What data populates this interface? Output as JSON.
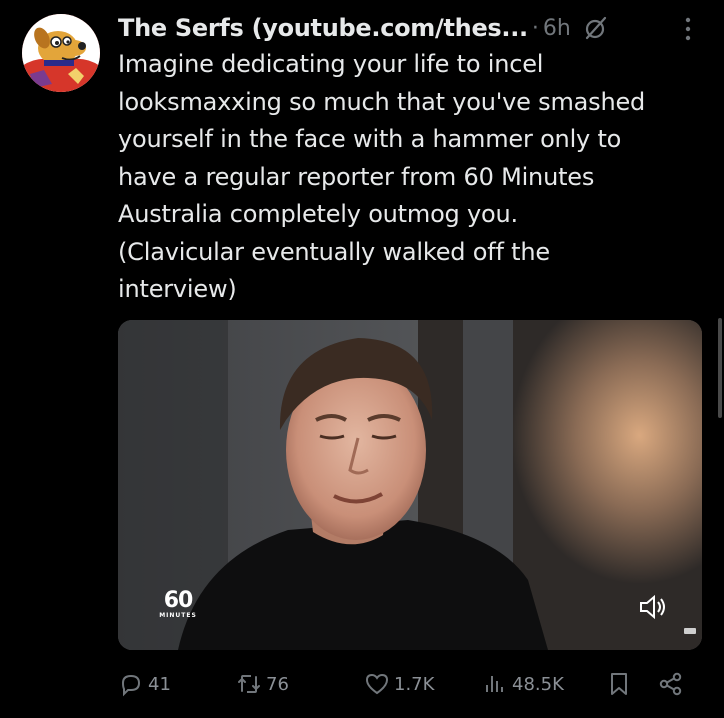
{
  "post": {
    "author": "The Serfs (youtube.com/thes...",
    "separator": "·",
    "time": "6h",
    "text": "Imagine dedicating your life to incel\nlooksmaxxing so much that you've smashed\nyourself in the face with a hammer only to\nhave a regular reporter from 60 Minutes\nAustralia completely outmog you.\n(Clavicular eventually walked off the\ninterview)",
    "video": {
      "watermark_number": "60",
      "watermark_sub": "MINUTES",
      "watermark_icon": "60-minutes-logo",
      "sound_icon": "volume-icon"
    }
  },
  "actions": {
    "replies": {
      "count": "41",
      "icon": "reply-icon"
    },
    "reposts": {
      "count": "76",
      "icon": "repost-icon"
    },
    "likes": {
      "count": "1.7K",
      "icon": "heart-icon"
    },
    "views": {
      "count": "48.5K",
      "icon": "views-icon"
    },
    "bookmark": {
      "icon": "bookmark-icon"
    },
    "share": {
      "icon": "share-icon"
    }
  },
  "colors": {
    "background": "#000000",
    "text": "#e7e9ea",
    "muted": "#71767b",
    "avatar_bg": "#d6362a"
  }
}
